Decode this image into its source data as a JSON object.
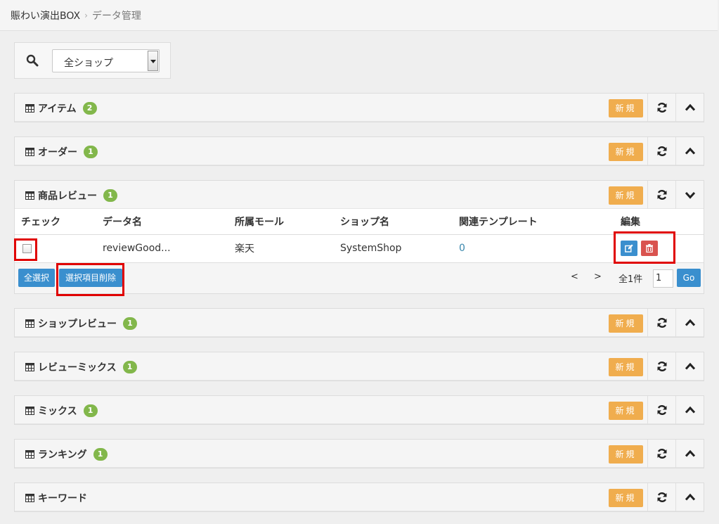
{
  "breadcrumb": {
    "home": "賑わい演出BOX",
    "separator": "›",
    "current": "データ管理"
  },
  "filter": {
    "shop_select_value": "全ショップ"
  },
  "colors": {
    "accent_orange": "#f0ad4e",
    "badge_green": "#82b74b",
    "primary_blue": "#3a8fce",
    "danger_red": "#d9534f",
    "highlight_red": "#e00000"
  },
  "panels": [
    {
      "title": "アイテム",
      "count": "2",
      "new_label": "新規"
    },
    {
      "title": "オーダー",
      "count": "1",
      "new_label": "新規"
    },
    {
      "title": "商品レビュー",
      "count": "1",
      "new_label": "新規"
    },
    {
      "title": "ショップレビュー",
      "count": "1",
      "new_label": "新規"
    },
    {
      "title": "レビューミックス",
      "count": "1",
      "new_label": "新規"
    },
    {
      "title": "ミックス",
      "count": "1",
      "new_label": "新規"
    },
    {
      "title": "ランキング",
      "count": "1",
      "new_label": "新規"
    },
    {
      "title": "キーワード",
      "count": "",
      "new_label": "新規"
    }
  ],
  "review_table": {
    "headers": {
      "check": "チェック",
      "name": "データ名",
      "mall": "所属モール",
      "shop": "ショップ名",
      "templates": "関連テンプレート",
      "edit": "編集"
    },
    "rows": [
      {
        "name": "reviewGood...",
        "mall": "楽天",
        "shop": "SystemShop",
        "templates": "0",
        "checked": false
      }
    ]
  },
  "footer": {
    "select_all": "全選択",
    "delete_selected": "選択項目削除",
    "prev": "<",
    "next": ">",
    "total": "全1件",
    "page_value": "1",
    "go": "Go"
  }
}
